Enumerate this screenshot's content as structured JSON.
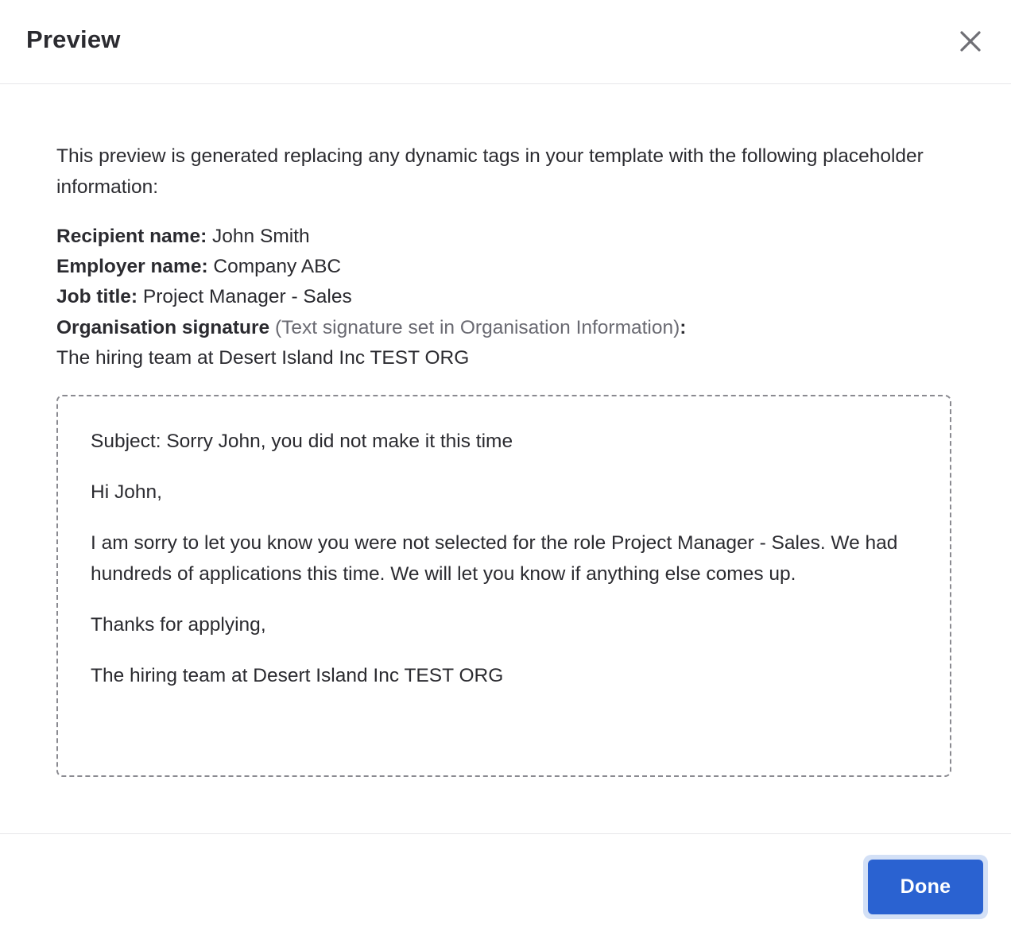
{
  "dialog": {
    "title": "Preview",
    "close_icon": "close-icon"
  },
  "intro": {
    "text": "This preview is generated replacing any dynamic tags in your template with the following placeholder information:"
  },
  "placeholders": {
    "recipient": {
      "label": "Recipient name:",
      "value": " John Smith"
    },
    "employer": {
      "label": "Employer name:",
      "value": " Company ABC"
    },
    "job_title": {
      "label": "Job title:",
      "value": " Project Manager - Sales"
    },
    "signature": {
      "label": "Organisation signature",
      "note": " (Text signature set in Organisation Information)",
      "colon": ":",
      "value": "The hiring team at Desert Island Inc TEST ORG"
    }
  },
  "email": {
    "subject": "Subject: Sorry John, you did not make it this time",
    "greeting": "Hi John,",
    "body": "I am sorry to let you know you were not selected for the role Project Manager - Sales. We had hundreds of applications this time. We will let you know if anything else comes up.",
    "closing": "Thanks for applying,",
    "signature": "The hiring team at Desert Island Inc TEST ORG"
  },
  "footer": {
    "done_label": "Done"
  },
  "colors": {
    "primary_button": "#2a62d1",
    "focus_ring": "#d3e0f6",
    "text": "#2b2b30",
    "muted_text": "#6a6a72",
    "dashed_border": "#8a8a90"
  }
}
